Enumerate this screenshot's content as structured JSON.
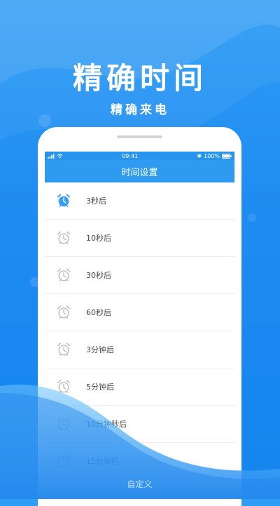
{
  "headline": "精确时间",
  "subheadline": "精确来电",
  "statusbar": {
    "time": "09:41",
    "battery": "100%"
  },
  "nav_title": "时间设置",
  "items": [
    {
      "label": "3秒后",
      "active": true
    },
    {
      "label": "10秒后",
      "active": false
    },
    {
      "label": "30秒后",
      "active": false
    },
    {
      "label": "60秒后",
      "active": false
    },
    {
      "label": "3分钟后",
      "active": false
    },
    {
      "label": "5分钟后",
      "active": false
    },
    {
      "label": "10分钟秒后",
      "active": false
    },
    {
      "label": "15分钟后",
      "active": false
    }
  ],
  "custom_button": "自定义",
  "colors": {
    "accent": "#2e9af0",
    "active_icon": "#3a9df0",
    "inactive_icon": "#b8b8b8"
  }
}
